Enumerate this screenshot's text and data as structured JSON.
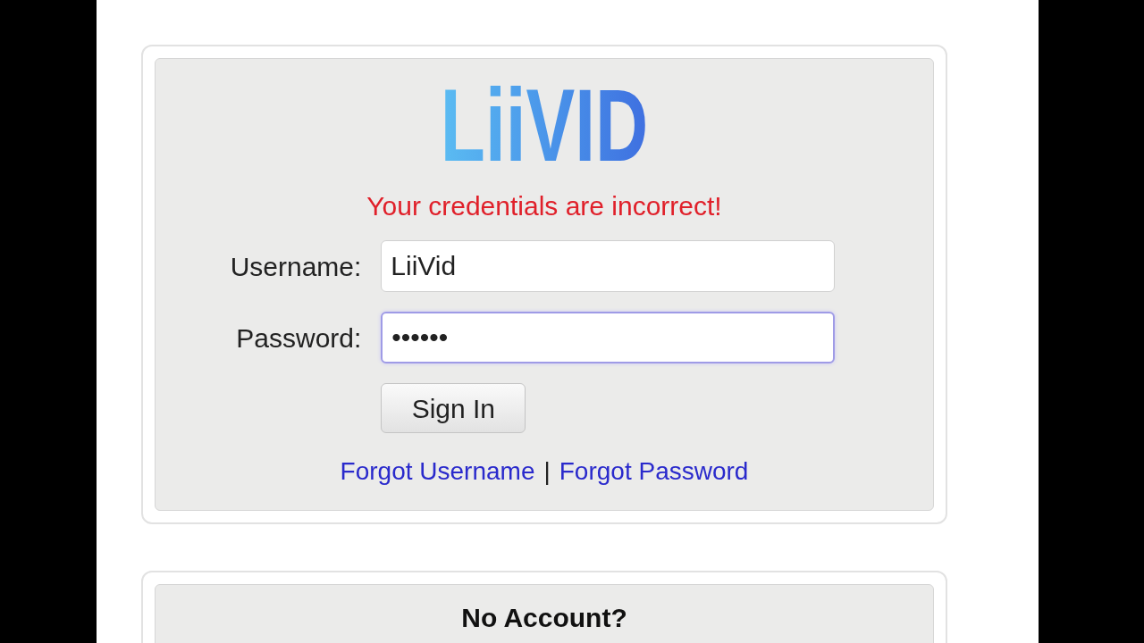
{
  "logo": {
    "text": "LiiVID"
  },
  "error_message": "Your credentials are incorrect!",
  "fields": [
    {
      "label": "Username:",
      "value": "LiiVid",
      "focused": false
    },
    {
      "label": "Password:",
      "value": "••••••",
      "focused": true
    }
  ],
  "sign_in_button": "Sign In",
  "links": [
    {
      "label": "Forgot Username"
    },
    {
      "label": "Forgot Password"
    }
  ],
  "link_separator": "|",
  "signup_card": {
    "title": "No Account?"
  }
}
